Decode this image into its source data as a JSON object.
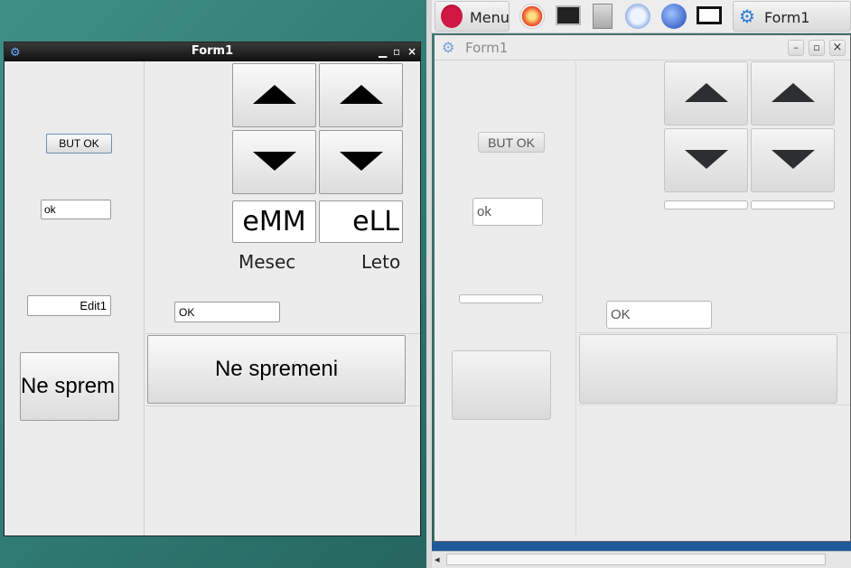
{
  "left_window": {
    "title": "Form1",
    "controls": {
      "minimize": "▁",
      "maximize": "▫",
      "close": "×"
    },
    "but_ok_label": "BUT OK",
    "edit_ok_value": "ok",
    "edit1_value": "Edit1",
    "ne_sprem_label": "Ne sprem",
    "emm_label": "eMM",
    "ell_label": "eLL",
    "mesec_label": "Mesec",
    "leto_label": "Leto",
    "edit_upper_ok_value": "OK",
    "ne_spremeni_label": "Ne spremeni"
  },
  "taskbar": {
    "menu_label": "Menu",
    "form1_label": "Form1",
    "icons": [
      "raspberry-icon",
      "burn-icon",
      "monitor-icon",
      "file-cabinet-icon",
      "network-icon",
      "globe-icon",
      "keyboard-icon",
      "lazarus-icon"
    ]
  },
  "right_window": {
    "title": "Form1",
    "controls": {
      "minimize": "–",
      "maximize": "▫",
      "close": "×"
    },
    "but_ok_label": "BUT OK",
    "edit_ok_value": "ok",
    "edit_upper_ok_value": "OK"
  }
}
